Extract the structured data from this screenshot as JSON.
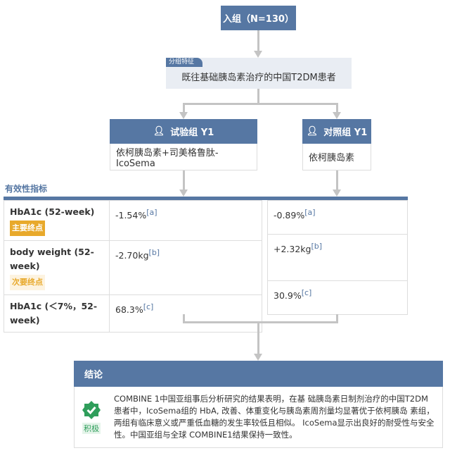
{
  "enroll": "入组（N=130）",
  "feature": {
    "tag": "分组特征",
    "text": "既往基础胰岛素治疗的中国T2DM患者"
  },
  "groups": [
    {
      "title": "试验组 Y1",
      "drug": "依柯胰岛素+司美格鲁肽-IcoSema"
    },
    {
      "title": "对照组 Y1",
      "drug": "依柯胰岛素"
    }
  ],
  "efficacy": {
    "title": "有效性指标",
    "rows": [
      {
        "label": "HbA1c (52-week)",
        "badge": "主要终点",
        "v1": "-1.54%",
        "n1": "[a]",
        "v2": "-0.89%",
        "n2": "[a]"
      },
      {
        "label": "body weight (52-week)",
        "badge": "次要终点",
        "v1": "-2.70kg",
        "n1": "[b]",
        "v2": "+2.32kg",
        "n2": "[b]"
      },
      {
        "label": "HbA1c (＜7%，52-week)",
        "v1": "68.3%",
        "n1": "[c]",
        "v2": "30.9%",
        "n2": "[c]"
      }
    ]
  },
  "conclusion": {
    "title": "结论",
    "badge": "积极",
    "text": "COMBINE 1中国亚组事后分析研究的结果表明，在基 础胰岛素日制剂治疗的中国T2DM患者中，IcoSema组的 HbA, 改善、体重变化与胰岛素周剂量均显著优于依柯胰岛 素组，两组有临床意义或严重低血糖的发生率较低且相似。 IcoSema显示出良好的耐受性与安全性。中国亚组与全球 COMBINE1结果保持一致性。"
  },
  "colors": {
    "primary": "#5677a3",
    "primary_badge": "#e8a92b",
    "positive": "#2f9e5b"
  }
}
